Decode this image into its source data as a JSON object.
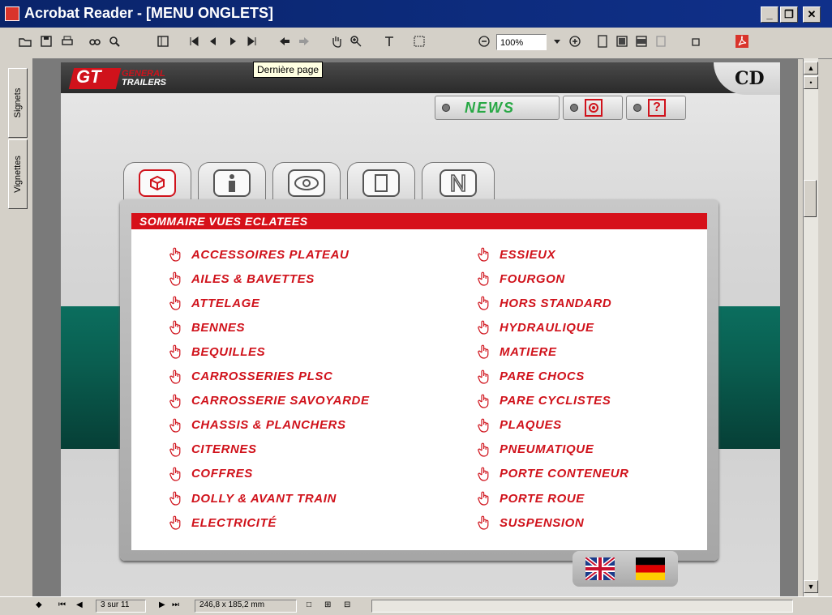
{
  "window": {
    "title": "Acrobat Reader - [MENU ONGLETS]",
    "min_label": "_",
    "max_label": "❐",
    "close_label": "✕"
  },
  "toolbar": {
    "zoom_value": "100%",
    "tooltip": "Dernière page"
  },
  "side_tabs": [
    "Signets",
    "Vignettes"
  ],
  "document": {
    "logo_line1": "GENERAL",
    "logo_line2": "TRAILERS",
    "logo_mark": "GT",
    "cd_label": "CD",
    "news_label": "NEWS",
    "help_label": "?",
    "panel_title": "SOMMAIRE VUES ECLATEES",
    "left_items": [
      "ACCESSOIRES PLATEAU",
      "AILES & BAVETTES",
      "ATTELAGE",
      "BENNES",
      "BEQUILLES",
      "CARROSSERIES PLSC",
      "CARROSSERIE SAVOYARDE",
      "CHASSIS & PLANCHERS",
      "CITERNES",
      "COFFRES",
      "DOLLY & AVANT TRAIN",
      "ELECTRICITÉ"
    ],
    "right_items": [
      "ESSIEUX",
      "FOURGON",
      "HORS STANDARD",
      "HYDRAULIQUE",
      "MATIERE",
      "PARE CHOCS",
      "PARE CYCLISTES",
      "PLAQUES",
      "PNEUMATIQUE",
      "PORTE CONTENEUR",
      "PORTE ROUE",
      "SUSPENSION"
    ],
    "accent_color": "#d0121b"
  },
  "status": {
    "page_indicator": "3 sur 11",
    "page_size": "246,8 x 185,2 mm"
  }
}
